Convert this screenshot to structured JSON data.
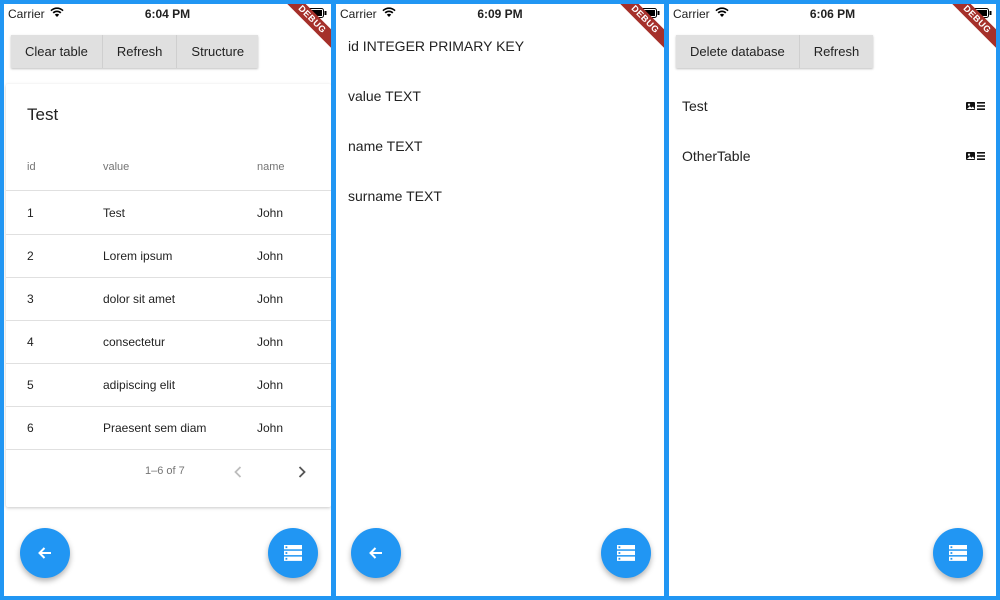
{
  "screens": [
    {
      "status": {
        "carrier": "Carrier",
        "time": "6:04 PM"
      },
      "debug_label": "DEBUG",
      "buttons": [
        "Clear table",
        "Refresh",
        "Structure"
      ],
      "table": {
        "title": "Test",
        "columns": [
          "id",
          "value",
          "name"
        ],
        "rows": [
          [
            "1",
            "Test",
            "John"
          ],
          [
            "2",
            "Lorem ipsum",
            "John"
          ],
          [
            "3",
            "dolor sit amet",
            "John"
          ],
          [
            "4",
            "consectetur",
            "John"
          ],
          [
            "5",
            "adipiscing elit",
            "John"
          ],
          [
            "6",
            "Praesent sem diam",
            "John"
          ]
        ],
        "pagination": "1–6 of 7"
      },
      "fabs": {
        "left_icon": "arrow-back-icon",
        "right_icon": "storage-icon"
      }
    },
    {
      "status": {
        "carrier": "Carrier",
        "time": "6:09 PM"
      },
      "debug_label": "DEBUG",
      "columns": [
        "id INTEGER PRIMARY KEY",
        "value TEXT",
        "name TEXT",
        "surname TEXT"
      ],
      "fabs": {
        "left_icon": "arrow-back-icon",
        "right_icon": "storage-icon"
      }
    },
    {
      "status": {
        "carrier": "Carrier",
        "time": "6:06 PM"
      },
      "debug_label": "DEBUG",
      "buttons": [
        "Delete database",
        "Refresh"
      ],
      "tables": [
        "Test",
        "OtherTable"
      ],
      "item_icon": "table-view-icon",
      "fabs": {
        "right_icon": "storage-icon"
      }
    }
  ],
  "colors": {
    "accent": "#2196F3",
    "debug_ribbon": "#a5302a"
  }
}
